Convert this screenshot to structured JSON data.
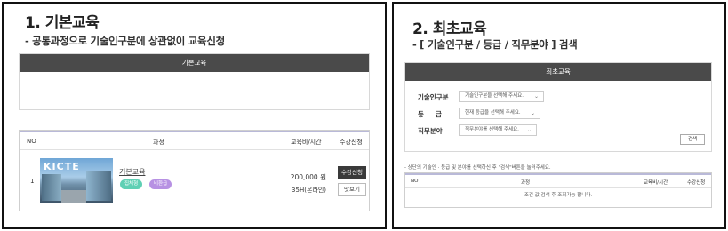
{
  "left": {
    "title": "1. 기본교육",
    "subtitle": "- 공통과정으로 기술인구분에 상관없이 교육신청",
    "basic_box_header": "기본교육",
    "table": {
      "headers": {
        "no": "NO",
        "course": "과정",
        "fee": "교육비/시간",
        "apply": "수강신청"
      },
      "row": {
        "no": "1",
        "thumb_text": "KICTE",
        "course_name": "기본교육",
        "tags": [
          "집체형",
          "비환급"
        ],
        "fee": "200,000 원",
        "hours": "35H(온라인)",
        "enroll_label": "수강신청",
        "view_label": "맛보기"
      }
    }
  },
  "right": {
    "title": "2. 최초교육",
    "subtitle": "- [ 기술인구분 / 등급 / 직무분야 ] 검색",
    "search_header": "최초교육",
    "filters": [
      {
        "label": "기술인구분",
        "placeholder": "기술인구분을 선택해 주세요."
      },
      {
        "label": "등     급",
        "placeholder": "현재 등급을 선택해 주세요."
      },
      {
        "label": "직무분야",
        "placeholder": "직무분야를 선택해 주세요."
      }
    ],
    "search_label": "검색",
    "note": "- 상단의 기술인 · 등급 및 분야를 선택하신 후 \"검색\"버튼을 눌러주세요.",
    "table": {
      "headers": {
        "no": "NO",
        "course": "과정",
        "fee": "교육비/시간",
        "apply": "수강신청"
      },
      "empty_text": "조건 값 검색 후 조회가능 합니다."
    }
  },
  "colors": {
    "dark_header": "#4a4a4a",
    "tag_green": "#5fd0b4",
    "tag_purple": "#b791e3",
    "enroll_btn": "#3a3a3a"
  }
}
